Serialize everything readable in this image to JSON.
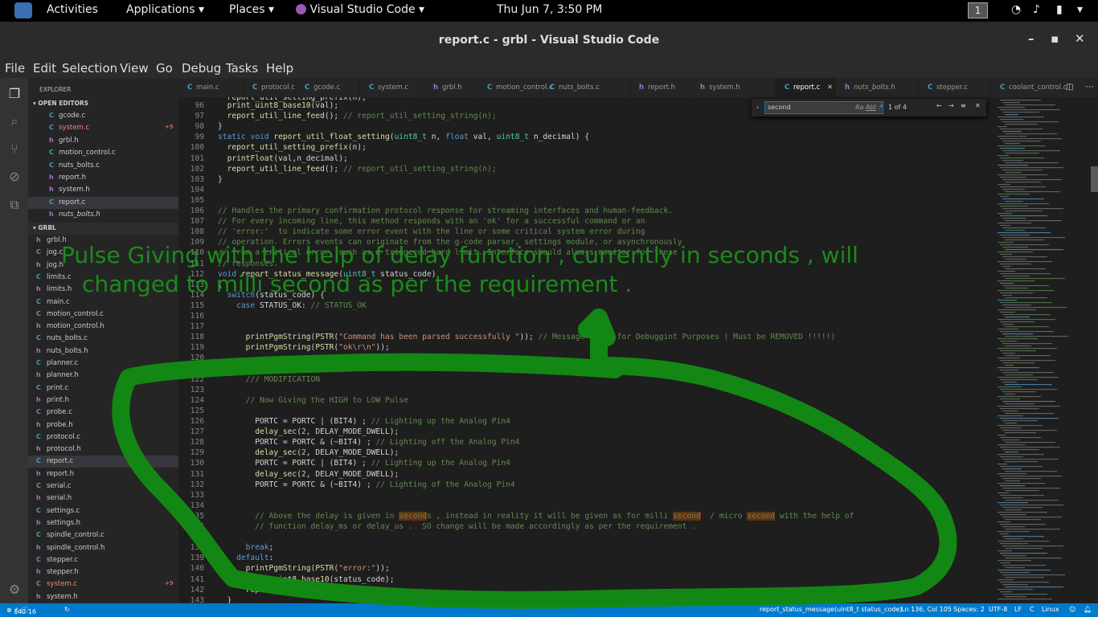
{
  "topbar": {
    "activities": "Activities",
    "applications": "Applications",
    "places": "Places",
    "app_name": "Visual Studio Code",
    "clock": "Thu Jun  7,  3:50 PM",
    "workspace": "1"
  },
  "window": {
    "title": "report.c - grbl - Visual Studio Code"
  },
  "menu": [
    "File",
    "Edit",
    "Selection",
    "View",
    "Go",
    "Debug",
    "Tasks",
    "Help"
  ],
  "sidebar": {
    "explorer_title": "EXPLORER",
    "open_editors_title": "OPEN EDITORS",
    "open_editors": [
      {
        "name": "gcode.c",
        "badge": ""
      },
      {
        "name": "system.c",
        "badge": "+9"
      },
      {
        "name": "grbl.h",
        "badge": ""
      },
      {
        "name": "motion_control.c",
        "badge": ""
      },
      {
        "name": "nuts_bolts.c",
        "badge": ""
      },
      {
        "name": "report.h",
        "badge": ""
      },
      {
        "name": "system.h",
        "badge": ""
      },
      {
        "name": "report.c",
        "badge": ""
      },
      {
        "name": "nuts_bolts.h",
        "badge": ""
      }
    ],
    "folder_title": "GRBL",
    "files": [
      {
        "name": "grbl.h",
        "badge": ""
      },
      {
        "name": "jog.c",
        "badge": ""
      },
      {
        "name": "jog.h",
        "badge": ""
      },
      {
        "name": "limits.c",
        "badge": ""
      },
      {
        "name": "limits.h",
        "badge": ""
      },
      {
        "name": "main.c",
        "badge": ""
      },
      {
        "name": "motion_control.c",
        "badge": ""
      },
      {
        "name": "motion_control.h",
        "badge": ""
      },
      {
        "name": "nuts_bolts.c",
        "badge": ""
      },
      {
        "name": "nuts_bolts.h",
        "badge": ""
      },
      {
        "name": "planner.c",
        "badge": ""
      },
      {
        "name": "planner.h",
        "badge": ""
      },
      {
        "name": "print.c",
        "badge": ""
      },
      {
        "name": "print.h",
        "badge": ""
      },
      {
        "name": "probe.c",
        "badge": ""
      },
      {
        "name": "probe.h",
        "badge": ""
      },
      {
        "name": "protocol.c",
        "badge": ""
      },
      {
        "name": "protocol.h",
        "badge": ""
      },
      {
        "name": "report.c",
        "badge": ""
      },
      {
        "name": "report.h",
        "badge": ""
      },
      {
        "name": "serial.c",
        "badge": ""
      },
      {
        "name": "serial.h",
        "badge": ""
      },
      {
        "name": "settings.c",
        "badge": ""
      },
      {
        "name": "settings.h",
        "badge": ""
      },
      {
        "name": "spindle_control.c",
        "badge": ""
      },
      {
        "name": "spindle_control.h",
        "badge": ""
      },
      {
        "name": "stepper.c",
        "badge": ""
      },
      {
        "name": "stepper.h",
        "badge": ""
      },
      {
        "name": "system.c",
        "badge": "+9"
      },
      {
        "name": "system.h",
        "badge": ""
      }
    ]
  },
  "tabs": [
    "main.c",
    "protocol.c",
    "gcode.c",
    "system.c",
    "grbl.h",
    "motion_control.c",
    "nuts_bolts.c",
    "report.h",
    "system.h",
    "report.c",
    "nuts_bolts.h",
    "stepper.c",
    "coolant_control.c"
  ],
  "find": {
    "query": "second",
    "result": "1 of 4",
    "opt_case": "Aa",
    "opt_word": "Abl",
    "opt_regex": ".*"
  },
  "code": [
    {
      "n": "96",
      "html": "  <span class=\"fn\">print_uint8_base10</span>(val);"
    },
    {
      "n": "97",
      "html": "  <span class=\"fn\">report_util_line_feed</span>(); <span class=\"cm\">// report_util_setting_string(n);</span>"
    },
    {
      "n": "98",
      "html": "}"
    },
    {
      "n": "99",
      "html": "<span class=\"kw\">static</span> <span class=\"kw\">void</span> <span class=\"fn\">report_util_float_setting</span>(<span class=\"ty\">uint8_t</span> n, <span class=\"kw\">float</span> val, <span class=\"ty\">uint8_t</span> n_decimal) {"
    },
    {
      "n": "100",
      "html": "  <span class=\"fn\">report_util_setting_prefix</span>(n);"
    },
    {
      "n": "101",
      "html": "  <span class=\"fn\">printFloat</span>(val,n_decimal);"
    },
    {
      "n": "102",
      "html": "  <span class=\"fn\">report_util_line_feed</span>(); <span class=\"cm\">// report_util_setting_string(n);</span>"
    },
    {
      "n": "103",
      "html": "}"
    },
    {
      "n": "104",
      "html": ""
    },
    {
      "n": "105",
      "html": ""
    },
    {
      "n": "106",
      "html": "<span class=\"cm\">// Handles the primary confirmation protocol response for streaming interfaces and human-feedback.</span>"
    },
    {
      "n": "107",
      "html": "<span class=\"cm\">// For every incoming line, this method responds with an 'ok' for a successful command or an</span>"
    },
    {
      "n": "108",
      "html": "<span class=\"cm\">// 'error:'  to indicate some error event with the line or some critical system error during</span>"
    },
    {
      "n": "109",
      "html": "<span class=\"cm\">// operation. Errors events can originate from the g-code parser, settings module, or asynchronously</span>"
    },
    {
      "n": "110",
      "html": "<span class=\"cm\">// from a critical error, such as a triggered hard limit. Interface should always monitor for these</span>"
    },
    {
      "n": "111",
      "html": "<span class=\"cm\">// responses.</span>"
    },
    {
      "n": "112",
      "html": "<span class=\"kw\">void</span> <span class=\"fn\">report_status_message</span>(<span class=\"ty\">uint8_t</span> status_code)"
    },
    {
      "n": "113",
      "html": "{"
    },
    {
      "n": "114",
      "html": "  <span class=\"kw\">switch</span>(status_code) {"
    },
    {
      "n": "115",
      "html": "    <span class=\"kw\">case</span> STATUS_OK: <span class=\"cm\">// STATUS_OK</span>"
    },
    {
      "n": "116",
      "html": ""
    },
    {
      "n": "117",
      "html": ""
    },
    {
      "n": "118",
      "html": "      <span class=\"fn\">printPgmString</span>(<span class=\"fn\">PSTR</span>(<span class=\"st\">\"Command has been parsed successfully \"</span>)); <span class=\"cm\">// Message Added for Debuggint Purposes ( Must be REMOVED !!!!!)</span>"
    },
    {
      "n": "119",
      "html": "      <span class=\"fn\">printPgmString</span>(<span class=\"fn\">PSTR</span>(<span class=\"st\">\"ok\\r\\n\"</span>));"
    },
    {
      "n": "120",
      "html": ""
    },
    {
      "n": "121",
      "html": ""
    },
    {
      "n": "122",
      "html": "      <span class=\"cm\">/// MODIFICATION</span>"
    },
    {
      "n": "123",
      "html": ""
    },
    {
      "n": "124",
      "html": "      <span class=\"cm\">// Now Giving the HIGH to LOW Pulse</span>"
    },
    {
      "n": "125",
      "html": ""
    },
    {
      "n": "126",
      "html": "        PORTC = PORTC | (BIT4) ; <span class=\"cm\">// Lighting up the Analog Pin4</span>"
    },
    {
      "n": "127",
      "html": "        <span class=\"fn\">delay_sec</span>(<span class=\"nm\">2</span>, DELAY_MODE_DWELL);"
    },
    {
      "n": "128",
      "html": "        PORTC = PORTC &amp; (~BIT4) ; <span class=\"cm\">// Lighting off the Analog Pin4</span>"
    },
    {
      "n": "129",
      "html": "        <span class=\"fn\">delay_sec</span>(<span class=\"nm\">2</span>, DELAY_MODE_DWELL);"
    },
    {
      "n": "130",
      "html": "        PORTC = PORTC | (BIT4) ; <span class=\"cm\">// Lighting up the Analog Pin4</span>"
    },
    {
      "n": "131",
      "html": "        <span class=\"fn\">delay_sec</span>(<span class=\"nm\">2</span>, DELAY_MODE_DWELL);"
    },
    {
      "n": "132",
      "html": "        PORTC = PORTC &amp; (~BIT4) ; <span class=\"cm\">// Lighting of the Analog Pin4</span>"
    },
    {
      "n": "133",
      "html": ""
    },
    {
      "n": "134",
      "html": ""
    },
    {
      "n": "135",
      "html": "        <span class=\"cm\">// Above the delay is given in <span class=\"hl\">second</span>s , instead in reality it will be given as for milli <span class=\"hl\">second</span>  / micro <span class=\"hl\">second</span> with the help of</span>"
    },
    {
      "n": "136",
      "html": "        <span class=\"cm\">// function delay_ms or delay_us .  SO change will be made accordingly as per the requirement .</span>"
    },
    {
      "n": "137",
      "html": ""
    },
    {
      "n": "138",
      "html": "      <span class=\"kw\">break</span>;"
    },
    {
      "n": "139",
      "html": "    <span class=\"kw\">default</span>:"
    },
    {
      "n": "140",
      "html": "      <span class=\"fn\">printPgmString</span>(<span class=\"fn\">PSTR</span>(<span class=\"st\">\"error:\"</span>));"
    },
    {
      "n": "141",
      "html": "      <span class=\"fn\">print_uint8_base10</span>(status_code);"
    },
    {
      "n": "142",
      "html": "      <span class=\"fn\">report_util_line_feed</span>();"
    },
    {
      "n": "143",
      "html": "  }"
    }
  ],
  "annotation": {
    "line1": "Pulse Giving with the help of delay function , currently in seconds , will",
    "line2": "changed to milli second as per the requirement .",
    "color": "#1a8c1a"
  },
  "status": {
    "errors": "14",
    "warnings": "0",
    "info": "16",
    "breadcrumb": "report_status_message(uint8_t status_code)",
    "position": "Ln 136, Col 105",
    "spaces": "Spaces: 2",
    "encoding": "UTF-8",
    "eol": "LF",
    "language": "C",
    "platform": "Linux",
    "accent": "#007acc"
  }
}
